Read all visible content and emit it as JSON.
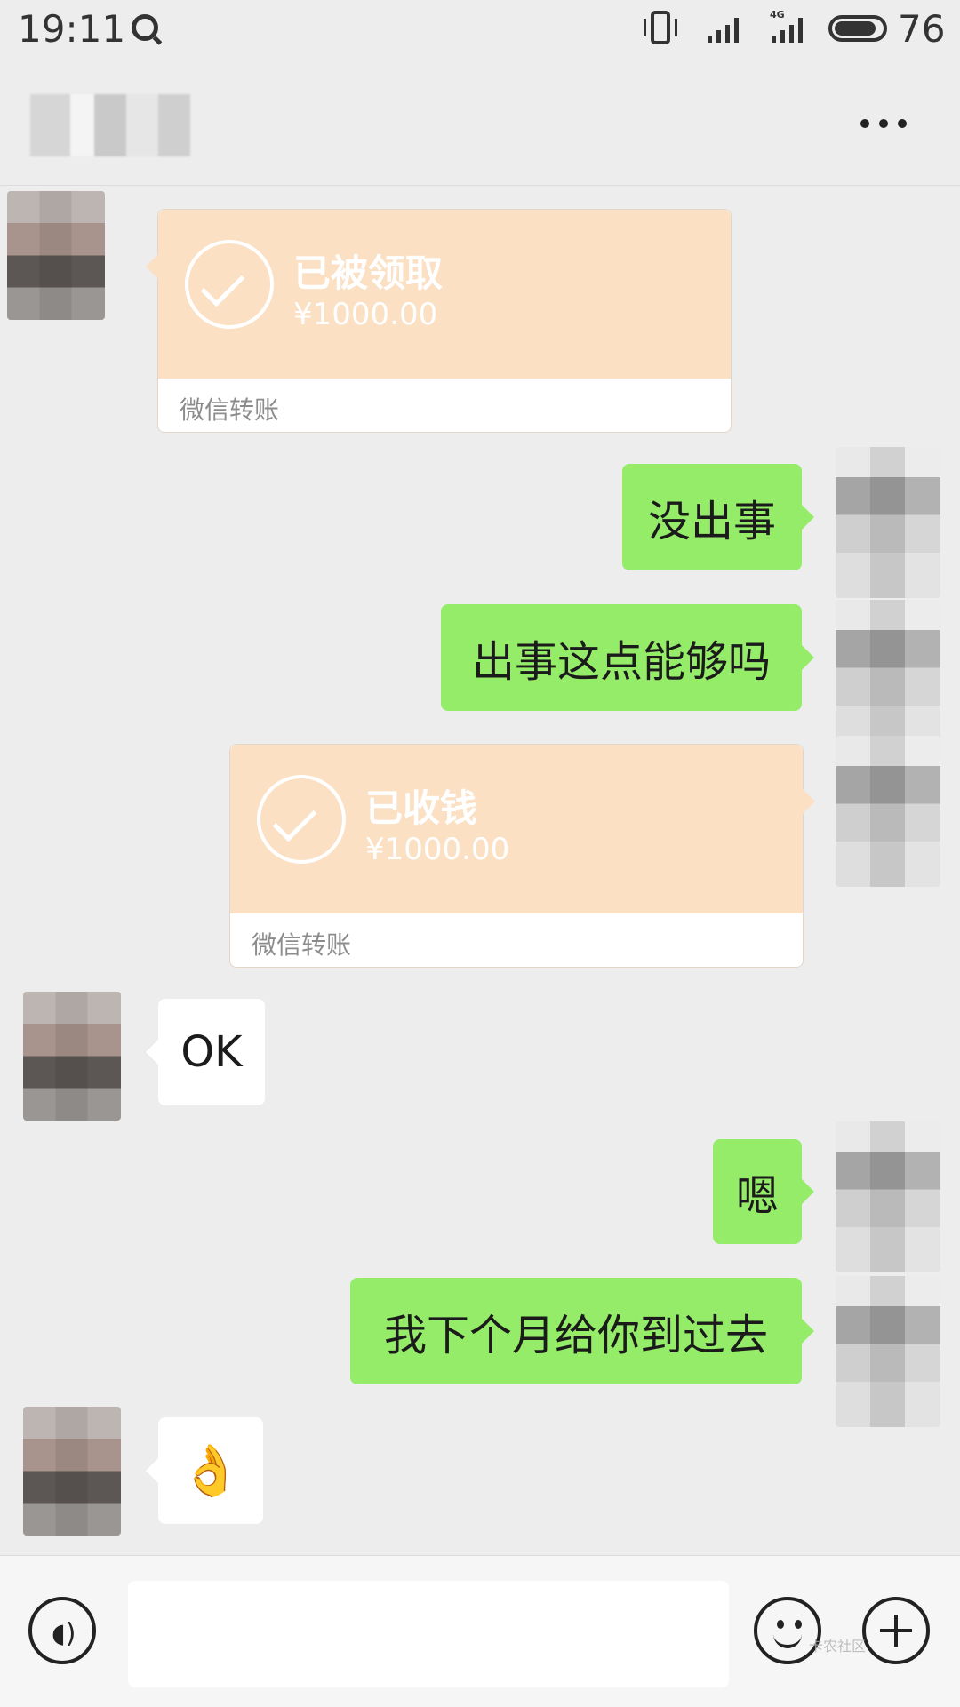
{
  "status_bar": {
    "time": "19:11",
    "network_label": "4G",
    "battery_level": "76"
  },
  "header": {
    "title": "",
    "more_icon": "more-dots-icon"
  },
  "messages": [
    {
      "id": "m1",
      "side": "left",
      "type": "transfer",
      "status": "已被领取",
      "amount": "¥1000.00",
      "label": "微信转账"
    },
    {
      "id": "m2",
      "side": "right",
      "type": "text",
      "text": "没出事"
    },
    {
      "id": "m3",
      "side": "right",
      "type": "text",
      "text": "出事这点能够吗"
    },
    {
      "id": "m4",
      "side": "right",
      "type": "transfer",
      "status": "已收钱",
      "amount": "¥1000.00",
      "label": "微信转账"
    },
    {
      "id": "m5",
      "side": "left",
      "type": "text",
      "text": "OK"
    },
    {
      "id": "m6",
      "side": "right",
      "type": "text",
      "text": "嗯"
    },
    {
      "id": "m7",
      "side": "right",
      "type": "text",
      "text": "我下个月给你到过去"
    },
    {
      "id": "m8",
      "side": "left",
      "type": "emoji",
      "emoji": "👌"
    }
  ],
  "input_bar": {
    "voice_icon": "voice-icon",
    "emoji_icon": "emoji-icon",
    "plus_icon": "plus-icon",
    "input_value": ""
  },
  "watermark": "卡农社区"
}
